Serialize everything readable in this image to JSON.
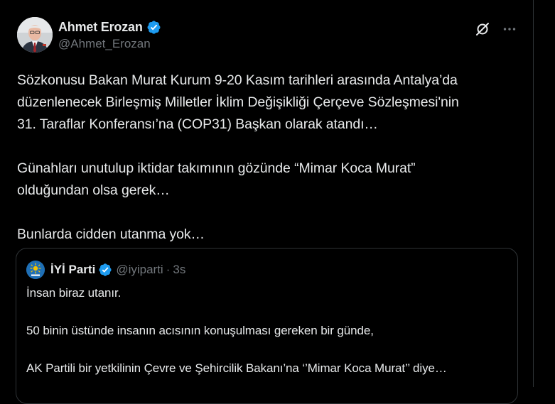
{
  "tweet": {
    "author": {
      "display_name": "Ahmet Erozan",
      "handle": "@Ahmet_Erozan",
      "verified": true
    },
    "text": "Sözkonusu Bakan Murat Kurum 9-20 Kasım tarihleri arasında Antalya’da\ndüzenlenecek Birleşmiş Milletler İklim Değişikliği Çerçeve Sözleşmesi'nin\n31. Taraflar Konferansı’na (COP31) Başkan olarak atandı…\n\nGünahları unutulup iktidar takımının gözünde “Mimar Koca Murat”\nolduğundan olsa gerek…\n\nBunlarda cidden utanma yok…",
    "actions": {
      "grok_icon": "grok-icon",
      "more_icon": "more-icon"
    }
  },
  "quote": {
    "author": {
      "display_name": "İYİ Parti",
      "handle": "@iyiparti",
      "verified": true
    },
    "separator": "·",
    "time": "3s",
    "text": "İnsan biraz utanır.\n\n50 binin üstünde insanın acısının konuşulması gereken bir günde,\n\nAK Partili bir yetkilinin Çevre ve Şehircilik Bakanı’na ‘’Mimar Koca Murat’’ diye…"
  },
  "colors": {
    "background": "#000000",
    "text_primary": "#e7e9ea",
    "text_secondary": "#71767b",
    "border": "#2f3336",
    "verified_blue": "#1d9bf0"
  }
}
